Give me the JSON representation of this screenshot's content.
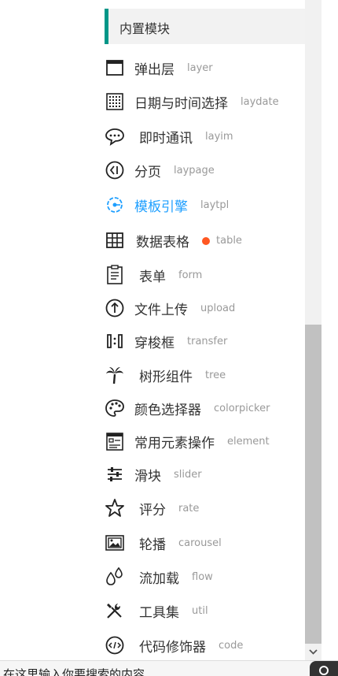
{
  "section": {
    "title": "内置模块"
  },
  "items": [
    {
      "zh": "弹出层",
      "en": "layer",
      "icon": "window-icon",
      "active": false,
      "dot": false
    },
    {
      "zh": "日期与时间选择",
      "en": "laydate",
      "icon": "calendar-icon",
      "active": false,
      "dot": false
    },
    {
      "zh": "即时通讯",
      "en": "layim",
      "icon": "chat-bubble-icon",
      "active": false,
      "dot": false
    },
    {
      "zh": "分页",
      "en": "laypage",
      "icon": "page-prev-icon",
      "active": false,
      "dot": false
    },
    {
      "zh": "模板引擎",
      "en": "laytpl",
      "icon": "template-gear-icon",
      "active": true,
      "dot": false
    },
    {
      "zh": "数据表格",
      "en": "table",
      "icon": "table-grid-icon",
      "active": false,
      "dot": true
    },
    {
      "zh": "表单",
      "en": "form",
      "icon": "form-clipboard-icon",
      "active": false,
      "dot": false
    },
    {
      "zh": "文件上传",
      "en": "upload",
      "icon": "upload-arrow-icon",
      "active": false,
      "dot": false
    },
    {
      "zh": "穿梭框",
      "en": "transfer",
      "icon": "transfer-icon",
      "active": false,
      "dot": false
    },
    {
      "zh": "树形组件",
      "en": "tree",
      "icon": "palm-tree-icon",
      "active": false,
      "dot": false
    },
    {
      "zh": "颜色选择器",
      "en": "colorpicker",
      "icon": "palette-icon",
      "active": false,
      "dot": false
    },
    {
      "zh": "常用元素操作",
      "en": "element",
      "icon": "element-doc-icon",
      "active": false,
      "dot": false
    },
    {
      "zh": "滑块",
      "en": "slider",
      "icon": "slider-icon",
      "active": false,
      "dot": false
    },
    {
      "zh": "评分",
      "en": "rate",
      "icon": "star-icon",
      "active": false,
      "dot": false
    },
    {
      "zh": "轮播",
      "en": "carousel",
      "icon": "image-carousel-icon",
      "active": false,
      "dot": false
    },
    {
      "zh": "流加载",
      "en": "flow",
      "icon": "drops-icon",
      "active": false,
      "dot": false
    },
    {
      "zh": "工具集",
      "en": "util",
      "icon": "tools-icon",
      "active": false,
      "dot": false
    },
    {
      "zh": "代码修饰器",
      "en": "code",
      "icon": "code-icon",
      "active": false,
      "dot": false
    }
  ],
  "colors": {
    "accent": "#009688",
    "active": "#1e9fff",
    "dot": "#ff5722"
  },
  "footer": {
    "text": "在这里输入你要搜索的内容"
  }
}
